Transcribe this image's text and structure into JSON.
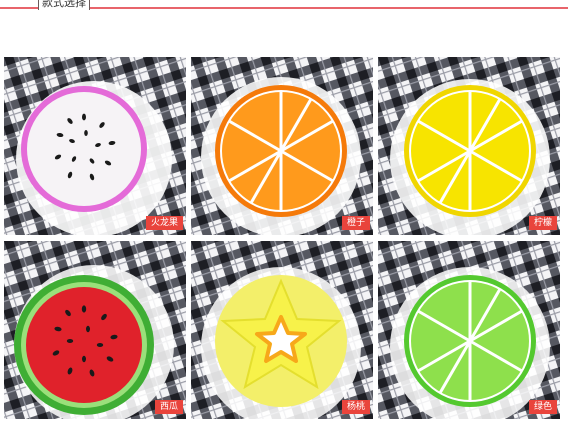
{
  "header": {
    "title": "款式选择"
  },
  "colors": {
    "accent": "#e8646b",
    "label_bg": "#e9443c"
  },
  "tiles": [
    {
      "label": "火龙果",
      "icon": "dragon-fruit-coaster"
    },
    {
      "label": "橙子",
      "icon": "orange-coaster"
    },
    {
      "label": "柠檬",
      "icon": "lemon-coaster"
    },
    {
      "label": "西瓜",
      "icon": "watermelon-coaster"
    },
    {
      "label": "杨桃",
      "icon": "starfruit-coaster"
    },
    {
      "label": "绿色",
      "icon": "lime-coaster"
    }
  ]
}
